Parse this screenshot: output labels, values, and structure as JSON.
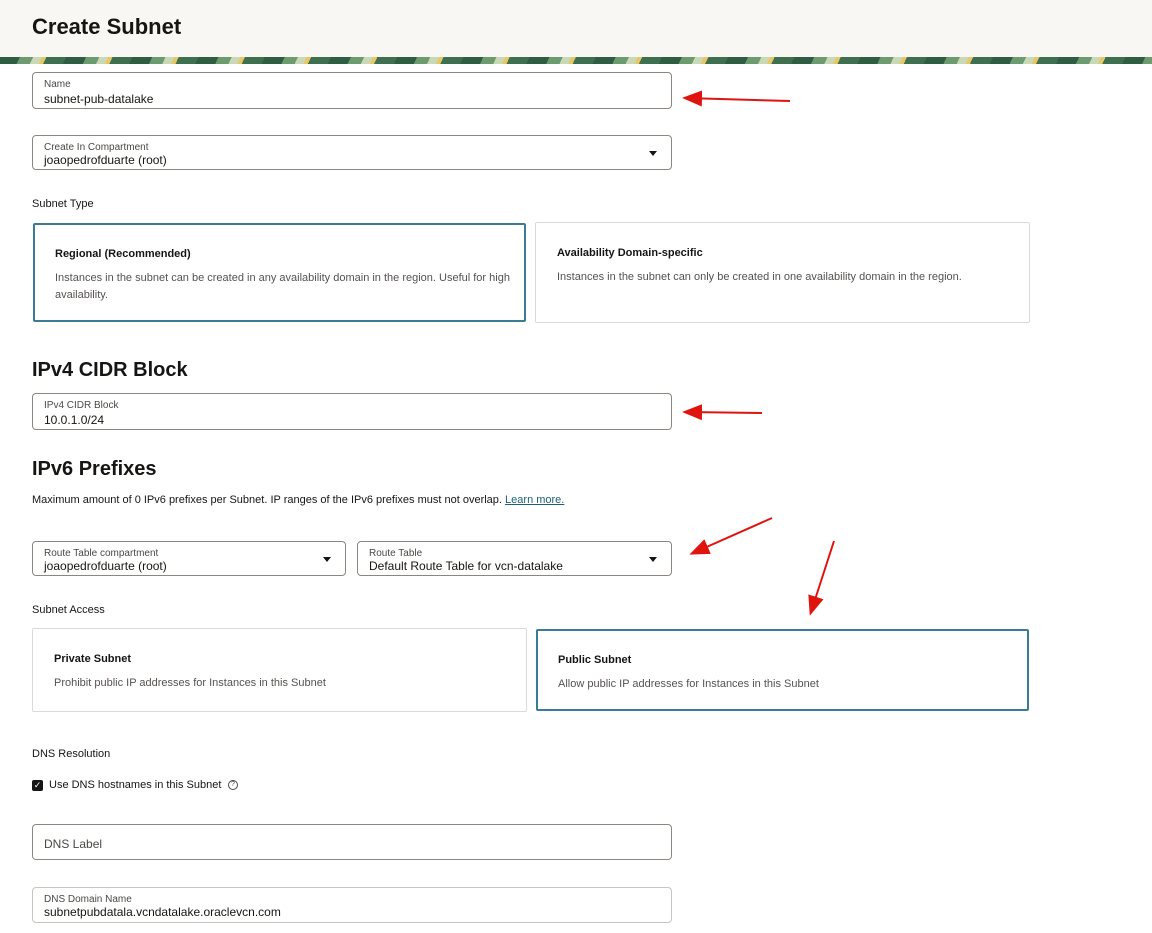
{
  "page": {
    "title": "Create Subnet"
  },
  "name_field": {
    "label": "Name",
    "value": "subnet-pub-datalake"
  },
  "compartment_field": {
    "label": "Create In Compartment",
    "value": "joaopedrofduarte (root)"
  },
  "subnet_type": {
    "label": "Subnet Type",
    "options": [
      {
        "title": "Regional (Recommended)",
        "description": "Instances in the subnet can be created in any availability domain in the region. Useful for high availability."
      },
      {
        "title": "Availability Domain-specific",
        "description": "Instances in the subnet can only be created in one availability domain in the region."
      }
    ],
    "selected": "Regional (Recommended)"
  },
  "ipv4": {
    "section_title": "IPv4 CIDR Block",
    "label": "IPv4 CIDR Block",
    "value": "10.0.1.0/24"
  },
  "ipv6": {
    "section_title": "IPv6 Prefixes",
    "info": "Maximum amount of 0 IPv6 prefixes per Subnet. IP ranges of the IPv6 prefixes must not overlap.",
    "learn_more": "Learn more."
  },
  "route_table_compartment": {
    "label": "Route Table compartment",
    "value": "joaopedrofduarte (root)"
  },
  "route_table": {
    "label": "Route Table",
    "value": "Default Route Table for vcn-datalake"
  },
  "subnet_access": {
    "label": "Subnet Access",
    "options": [
      {
        "title": "Private Subnet",
        "description": "Prohibit public IP addresses for Instances in this Subnet"
      },
      {
        "title": "Public Subnet",
        "description": "Allow public IP addresses for Instances in this Subnet"
      }
    ],
    "selected": "Public Subnet"
  },
  "dns": {
    "label": "DNS Resolution",
    "use_hostnames_label": "Use DNS hostnames in this Subnet",
    "use_hostnames_checked": true,
    "dns_label_placeholder": "DNS Label",
    "domain_label": "DNS Domain Name",
    "domain_value": "subnetpubdatala.vcndatalake.oraclevcn.com"
  },
  "colors": {
    "accent": "#3b7c93",
    "annotation": "#e0140f",
    "header_bg": "#f8f7f4"
  }
}
